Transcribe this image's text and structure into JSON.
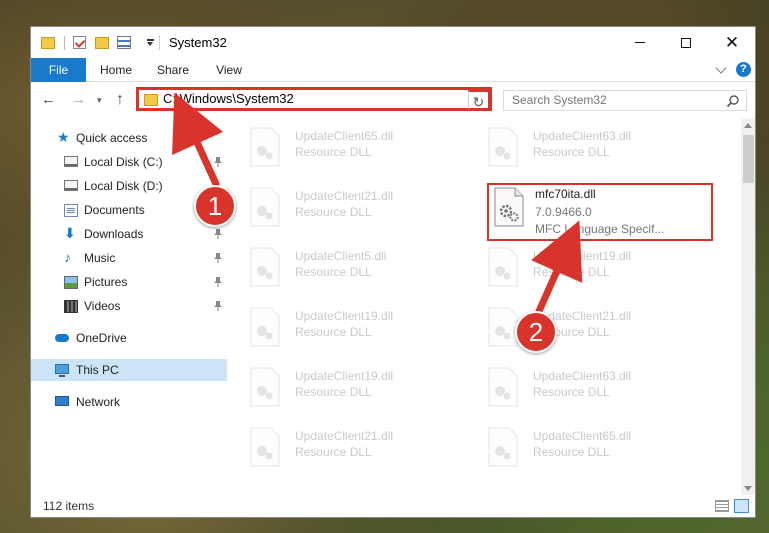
{
  "window": {
    "title": "System32"
  },
  "ribbon": {
    "tabs": [
      {
        "label": "File"
      },
      {
        "label": "Home"
      },
      {
        "label": "Share"
      },
      {
        "label": "View"
      }
    ]
  },
  "address": {
    "path": "C:\\Windows\\System32"
  },
  "search": {
    "placeholder": "Search System32"
  },
  "sidebar": {
    "items": [
      {
        "label": "Quick access",
        "icon": "star-icon"
      },
      {
        "label": "Local Disk (C:)",
        "icon": "disk-icon",
        "pinned": true
      },
      {
        "label": "Local Disk (D:)",
        "icon": "disk-icon",
        "pinned": false
      },
      {
        "label": "Documents",
        "icon": "documents-icon",
        "pinned": true
      },
      {
        "label": "Downloads",
        "icon": "download-icon",
        "pinned": true
      },
      {
        "label": "Music",
        "icon": "music-icon",
        "pinned": true
      },
      {
        "label": "Pictures",
        "icon": "pictures-icon",
        "pinned": true
      },
      {
        "label": "Videos",
        "icon": "video-icon",
        "pinned": true
      },
      {
        "label": "OneDrive",
        "icon": "cloud-icon"
      },
      {
        "label": "This PC",
        "icon": "pc-icon",
        "selected": true
      },
      {
        "label": "Network",
        "icon": "network-icon"
      }
    ]
  },
  "files": [
    {
      "name": "UpdateClient65.dll",
      "desc": "Resource DLL"
    },
    {
      "name": "UpdateClient63.dll",
      "desc": "Resource DLL"
    },
    {
      "name": "UpdateClient21.dll",
      "desc": "Resource DLL"
    },
    {
      "name": "mfc70ita.dll",
      "version": "7.0.9466.0",
      "desc": "MFC Language Specif...",
      "highlighted": true
    },
    {
      "name": "UpdateClient5.dll",
      "desc": "Resource DLL"
    },
    {
      "name": "UpdateClient19.dll",
      "desc": "Resource DLL"
    },
    {
      "name": "UpdateClient19.dll",
      "desc": "Resource DLL"
    },
    {
      "name": "UpdateClient21.dll",
      "desc": "Resource DLL"
    },
    {
      "name": "UpdateClient19.dll",
      "desc": "Resource DLL"
    },
    {
      "name": "UpdateClient63.dll",
      "desc": "Resource DLL"
    },
    {
      "name": "UpdateClient21.dll",
      "desc": "Resource DLL"
    },
    {
      "name": "UpdateClient65.dll",
      "desc": "Resource DLL"
    }
  ],
  "status": {
    "item_count": "112 items"
  },
  "callouts": {
    "one": "1",
    "two": "2"
  },
  "colors": {
    "accent": "#1979ca",
    "annotation": "#d9342b",
    "selected": "#cce4f7"
  }
}
